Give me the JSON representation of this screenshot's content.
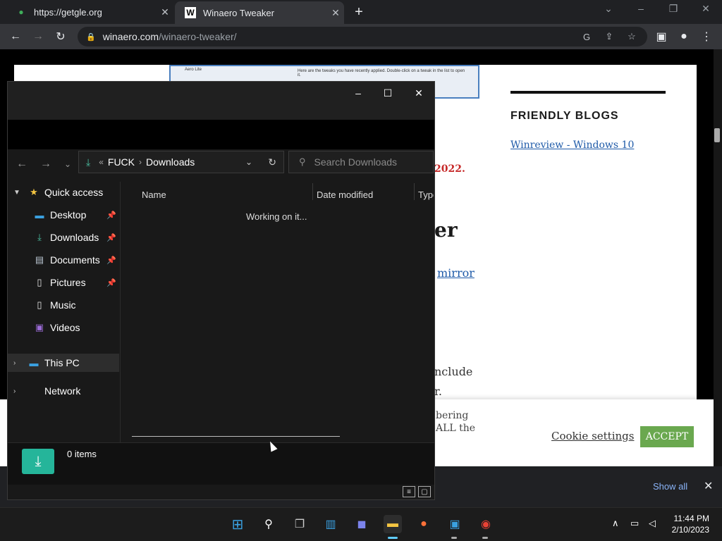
{
  "browser": {
    "tabs": [
      {
        "title": "https://getgle.org",
        "active": false
      },
      {
        "title": "Winaero Tweaker",
        "favicon_letter": "W",
        "active": true
      }
    ],
    "new_tab": "+",
    "address": {
      "host": "winaero.com",
      "path": "/winaero-tweaker/"
    }
  },
  "page": {
    "screenshot_text_1": "Aero Lite",
    "screenshot_text_2": "Here are the tweaks you have recently applied. Double-click on a tweak in the list to open it.",
    "friendly_blogs_heading": "FRIENDLY BLOGS",
    "blog_link": "Winreview - Windows 10",
    "red_fragment": "2022.",
    "big_fragment": "er",
    "link_fragment": "mirror",
    "text_fragment_1": "nclude",
    "text_fragment_2": "r."
  },
  "cookie_banner": {
    "text_1": "bering",
    "text_2": "ALL the",
    "settings_label": "Cookie settings",
    "accept_label": "ACCEPT"
  },
  "downloads_shelf": {
    "show_all": "Show all"
  },
  "explorer": {
    "address": {
      "root": "FUCK",
      "folder": "Downloads"
    },
    "search_placeholder": "Search Downloads",
    "sidebar": [
      {
        "label": "Quick access",
        "icon": "star-icon"
      },
      {
        "label": "Desktop",
        "icon": "desktop-icon",
        "pinned": true
      },
      {
        "label": "Downloads",
        "icon": "download-icon",
        "pinned": true
      },
      {
        "label": "Documents",
        "icon": "document-icon",
        "pinned": true
      },
      {
        "label": "Pictures",
        "icon": "picture-icon",
        "pinned": true
      },
      {
        "label": "Music",
        "icon": "music-icon"
      },
      {
        "label": "Videos",
        "icon": "video-icon"
      },
      {
        "label": "This PC",
        "icon": "computer-icon"
      },
      {
        "label": "Network",
        "icon": "network-icon"
      }
    ],
    "columns": [
      "Name",
      "Date modified",
      "Type"
    ],
    "status_message": "Working on it...",
    "item_count": "0 items"
  },
  "taskbar": {
    "clock_time": "11:44 PM",
    "clock_date": "2/10/2023"
  }
}
